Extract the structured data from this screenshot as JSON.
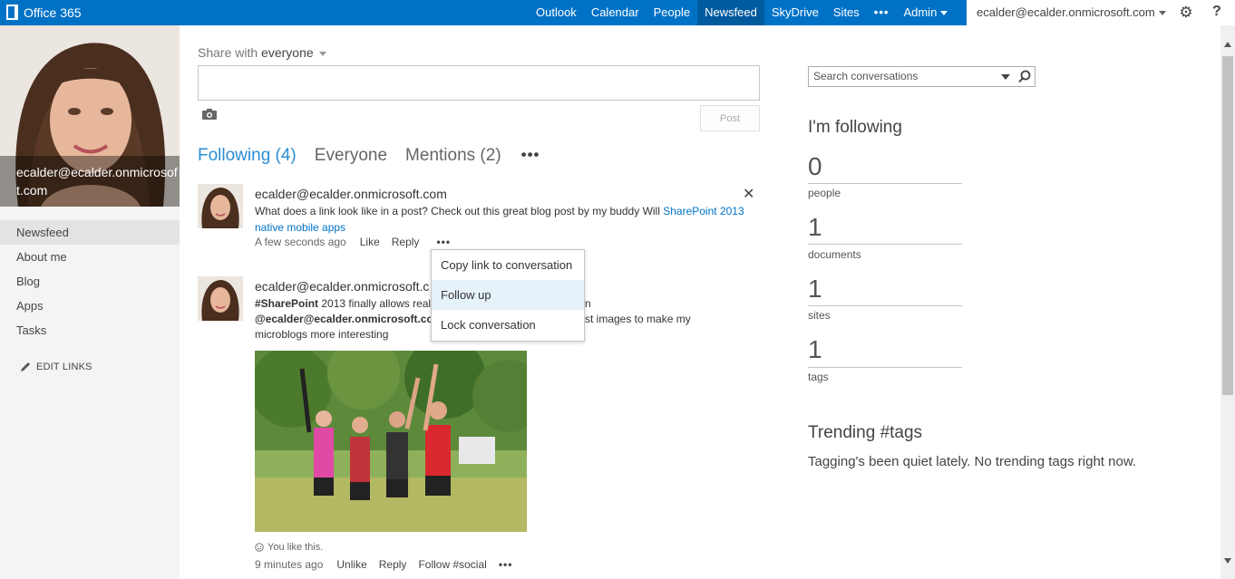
{
  "topbar": {
    "app_name": "Office 365",
    "nav": [
      "Outlook",
      "Calendar",
      "People",
      "Newsfeed",
      "SkyDrive",
      "Sites",
      "•••",
      "Admin"
    ],
    "active_nav": "Newsfeed",
    "user": "ecalder@ecalder.onmicrosoft.com",
    "accent_color": "#0072c6",
    "icons": [
      "office-logo-icon",
      "gear-icon",
      "help-icon"
    ]
  },
  "profile": {
    "name": "ecalder@ecalder.onmicrosoft.com"
  },
  "leftnav": {
    "items": [
      "Newsfeed",
      "About me",
      "Blog",
      "Apps",
      "Tasks"
    ],
    "active": "Newsfeed",
    "edit_links": "EDIT LINKS"
  },
  "share": {
    "label_prefix": "Share with",
    "label_audience": "everyone",
    "post_button": "Post"
  },
  "tabs": {
    "items": [
      "Following (4)",
      "Everyone",
      "Mentions (2)"
    ],
    "active": "Following (4)",
    "more": "•••"
  },
  "posts": [
    {
      "author": "ecalder@ecalder.onmicrosoft.com",
      "text_before": "What does a link look like in a post? Check out this great blog post by my buddy Will ",
      "link_text": "SharePoint 2013 native mobile apps",
      "time": "A few seconds ago",
      "actions": [
        "Like",
        "Reply",
        "•••"
      ]
    },
    {
      "author": "ecalder@ecalder.onmicrosoft.c",
      "hashtag": "#SharePoint",
      "line1_rest": " 2013 finally allows real #",
      "line1_end": "n",
      "mention": "@ecalder@ecalder.onmicrosoft.com",
      "line2_end": "st images to make my",
      "line3": "microblogs more interesting",
      "liked_text": "You like this.",
      "time": "9 minutes ago",
      "actions": [
        "Unlike",
        "Reply",
        "Follow #social",
        "•••"
      ]
    }
  ],
  "context_menu": {
    "items": [
      "Copy link to conversation",
      "Follow up",
      "Lock conversation"
    ],
    "highlighted": "Follow up"
  },
  "search": {
    "placeholder": "Search conversations"
  },
  "following": {
    "heading": "I'm following",
    "stats": [
      {
        "value": "0",
        "label": "people"
      },
      {
        "value": "1",
        "label": "documents"
      },
      {
        "value": "1",
        "label": "sites"
      },
      {
        "value": "1",
        "label": "tags"
      }
    ]
  },
  "trending": {
    "heading": "Trending #tags",
    "text": "Tagging's been quiet lately. No trending tags right now."
  }
}
